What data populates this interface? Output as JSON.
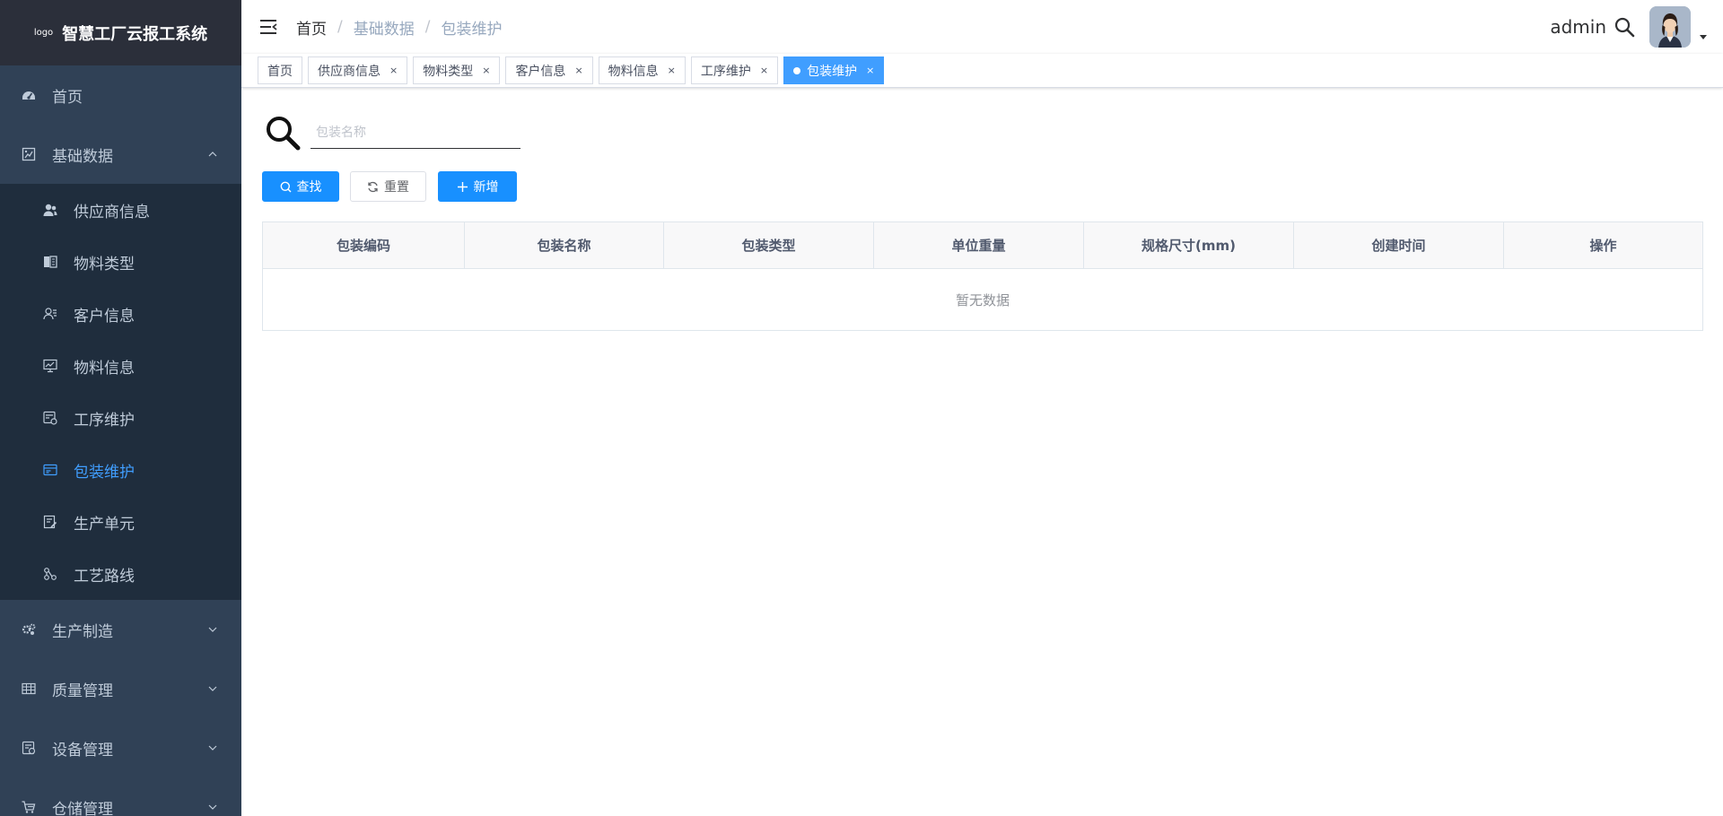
{
  "app": {
    "logo_text": "logo",
    "title": "智慧工厂云报工系统"
  },
  "sidebar": {
    "items": [
      {
        "label": "首页",
        "icon": "dashboard-icon"
      },
      {
        "label": "基础数据",
        "icon": "base-data-icon",
        "expanded": true,
        "children": [
          {
            "label": "供应商信息",
            "icon": "supplier-icon"
          },
          {
            "label": "物料类型",
            "icon": "material-type-icon"
          },
          {
            "label": "客户信息",
            "icon": "customer-icon"
          },
          {
            "label": "物料信息",
            "icon": "material-info-icon"
          },
          {
            "label": "工序维护",
            "icon": "process-icon"
          },
          {
            "label": "包装维护",
            "icon": "package-icon",
            "active": true
          },
          {
            "label": "生产单元",
            "icon": "production-unit-icon"
          },
          {
            "label": "工艺路线",
            "icon": "route-icon"
          }
        ]
      },
      {
        "label": "生产制造",
        "icon": "manufacturing-icon"
      },
      {
        "label": "质量管理",
        "icon": "quality-icon"
      },
      {
        "label": "设备管理",
        "icon": "equipment-icon"
      },
      {
        "label": "仓储管理",
        "icon": "warehouse-icon"
      }
    ]
  },
  "header": {
    "breadcrumb": [
      "首页",
      "基础数据",
      "包装维护"
    ],
    "username": "admin"
  },
  "tags": [
    {
      "label": "首页",
      "closable": false
    },
    {
      "label": "供应商信息",
      "closable": true
    },
    {
      "label": "物料类型",
      "closable": true
    },
    {
      "label": "客户信息",
      "closable": true
    },
    {
      "label": "物料信息",
      "closable": true
    },
    {
      "label": "工序维护",
      "closable": true
    },
    {
      "label": "包装维护",
      "closable": true,
      "active": true
    }
  ],
  "tag_close_glyph": "×",
  "search": {
    "placeholder": "包装名称",
    "value": ""
  },
  "buttons": {
    "search": "查找",
    "reset": "重置",
    "add": "新增"
  },
  "table": {
    "columns": [
      "包装编码",
      "包装名称",
      "包装类型",
      "单位重量",
      "规格尺寸(mm)",
      "创建时间",
      "操作"
    ],
    "rows": [],
    "empty_text": "暂无数据"
  },
  "colors": {
    "sidebar_bg": "#304156",
    "submenu_bg": "#1f2d3d",
    "active_text": "#409eff",
    "primary": "#1890ff",
    "active_tag": "#409eff"
  }
}
